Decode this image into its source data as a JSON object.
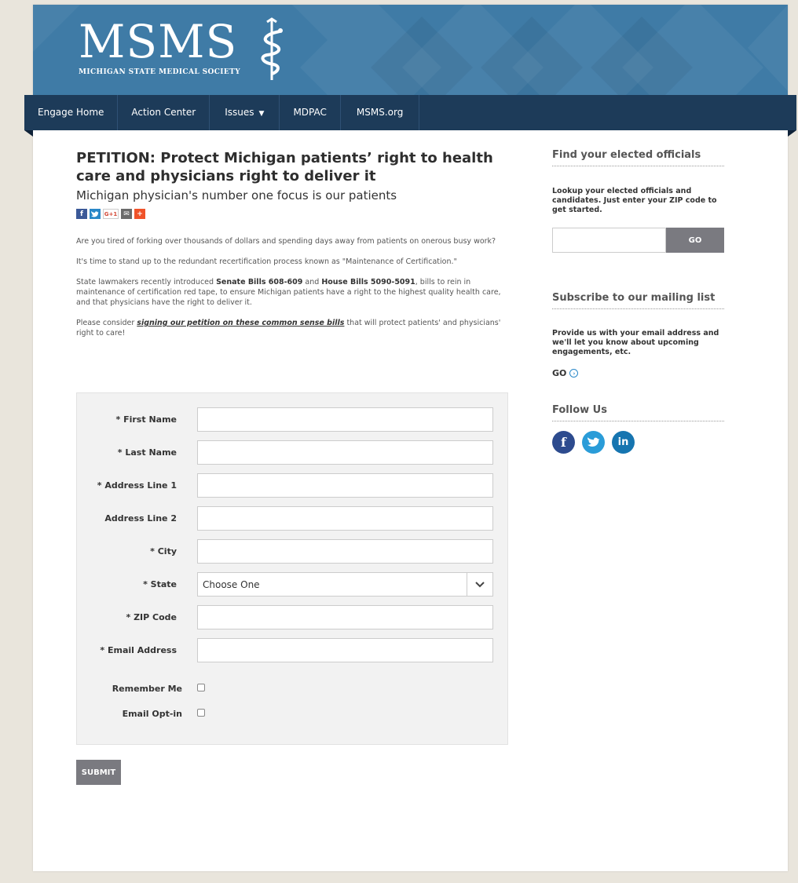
{
  "colors": {
    "banner": "#3f7ba6",
    "nav": "#1d3b59",
    "button": "#7a7a80",
    "accent": "#2a88c8"
  },
  "header": {
    "logo_text": "MSMS",
    "logo_subtitle": "MICHIGAN STATE MEDICAL SOCIETY"
  },
  "nav": {
    "items": [
      {
        "label": "Engage Home"
      },
      {
        "label": "Action Center"
      },
      {
        "label": "Issues"
      },
      {
        "label": "MDPAC"
      },
      {
        "label": "MSMS.org"
      }
    ]
  },
  "main": {
    "title": "PETITION: Protect Michigan patients’ right to health care and physicians right to deliver it",
    "subtitle": "Michigan physician's number one focus is our patients",
    "share_icons": [
      "facebook-icon",
      "twitter-icon",
      "google-plus-icon",
      "email-icon",
      "more-icon"
    ],
    "share": {
      "fb": "f",
      "gp": "G+1",
      "em": "✉",
      "pl": "+"
    },
    "p1": "Are you tired of forking over thousands of dollars and spending days away from patients on onerous busy work?",
    "p2": "It's time to stand up to the redundant recertification process known as \"Maintenance of Certification.\"",
    "p3": {
      "pre": "State lawmakers recently introduced ",
      "b1": "Senate Bills 608-609",
      "mid": " and ",
      "b2": "House Bills 5090-5091",
      "post": ", bills to rein in maintenance of certification red tape, to ensure Michigan patients have a right to the highest quality health care, and that physicians have the right to deliver it."
    },
    "p4": {
      "pre": "Please consider ",
      "link": "signing our petition on these common sense bills",
      "post": " that will protect patients' and physicians' right to care!"
    }
  },
  "form": {
    "first_name": {
      "label": "* First Name",
      "value": ""
    },
    "last_name": {
      "label": "* Last Name",
      "value": ""
    },
    "address1": {
      "label": "* Address Line 1",
      "value": ""
    },
    "address2": {
      "label": "Address Line 2",
      "value": ""
    },
    "city": {
      "label": "* City",
      "value": ""
    },
    "state": {
      "label": "* State",
      "value": "Choose One"
    },
    "zip": {
      "label": "* ZIP Code",
      "value": ""
    },
    "email": {
      "label": "* Email Address",
      "value": ""
    },
    "remember_me": {
      "label": "Remember Me",
      "checked": false
    },
    "email_optin": {
      "label": "Email Opt-in",
      "checked": false
    },
    "submit_label": "SUBMIT"
  },
  "sidebar": {
    "officials": {
      "heading": "Find your elected officials",
      "text": "Lookup your elected officials and candidates. Just enter your ZIP code to get started.",
      "zip_value": "",
      "go_label": "GO"
    },
    "mailing": {
      "heading": "Subscribe to our mailing list",
      "text": "Provide us with your email address and we'll let you know about upcoming engagements, etc.",
      "go_label": "GO"
    },
    "follow": {
      "heading": "Follow Us",
      "icons": [
        "facebook-icon",
        "twitter-icon",
        "linkedin-icon"
      ],
      "fb": "f",
      "li": "in"
    }
  }
}
